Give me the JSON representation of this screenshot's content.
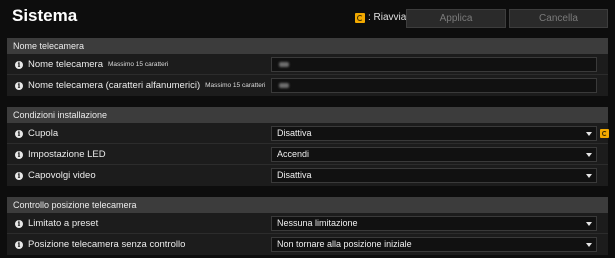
{
  "header": {
    "title": "Sistema",
    "restart_label": ": Riavvia",
    "apply_label": "Applica",
    "cancel_label": "Cancella"
  },
  "sections": [
    {
      "title": "Nome telecamera",
      "rows": [
        {
          "label": "Nome telecamera",
          "hint": "Massimo 15 caratteri",
          "type": "text"
        },
        {
          "label": "Nome telecamera (caratteri alfanumerici)",
          "hint": "Massimo 15 caratteri",
          "type": "text"
        }
      ]
    },
    {
      "title": "Condizioni installazione",
      "rows": [
        {
          "label": "Cupola",
          "type": "select",
          "value": "Disattiva",
          "restart": true
        },
        {
          "label": "Impostazione LED",
          "type": "select",
          "value": "Accendi"
        },
        {
          "label": "Capovolgi video",
          "type": "select",
          "value": "Disattiva"
        }
      ]
    },
    {
      "title": "Controllo posizione telecamera",
      "rows": [
        {
          "label": "Limitato a preset",
          "type": "select",
          "value": "Nessuna limitazione"
        },
        {
          "label": "Posizione telecamera senza controllo",
          "type": "select",
          "value": "Non tornare alla posizione iniziale"
        }
      ]
    }
  ],
  "colors": {
    "accent_restart": "#f2a900",
    "section_header_bg": "#3c3c3c",
    "panel_bg": "#1c1c1c"
  }
}
